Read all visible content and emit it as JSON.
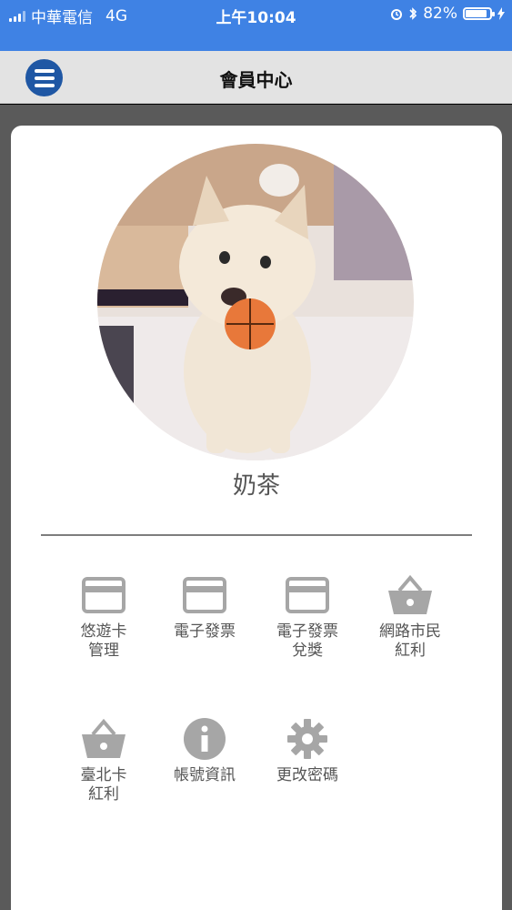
{
  "status_bar": {
    "carrier": "中華電信",
    "network": "4G",
    "time": "上午10:04",
    "battery_percent": "82%",
    "battery_level": 0.82
  },
  "nav": {
    "title": "會員中心",
    "menu_icon": "hamburger-menu-icon"
  },
  "profile": {
    "name": "奶茶",
    "avatar_description": "dog-photo"
  },
  "menu": [
    {
      "label": "悠遊卡\n管理",
      "icon": "card-icon"
    },
    {
      "label": "電子發票",
      "icon": "card-icon"
    },
    {
      "label": "電子發票\n兌獎",
      "icon": "card-icon"
    },
    {
      "label": "網路市民\n紅利",
      "icon": "basket-icon"
    },
    {
      "label": "臺北卡\n紅利",
      "icon": "basket-icon"
    },
    {
      "label": "帳號資訊",
      "icon": "info-icon"
    },
    {
      "label": "更改密碼",
      "icon": "gear-icon"
    }
  ],
  "colors": {
    "status_bar": "#3f82e4",
    "nav_bar": "#e3e3e3",
    "menu_button": "#1f57a4",
    "icon_gray": "#a6a6a6",
    "label_gray": "#555555"
  }
}
